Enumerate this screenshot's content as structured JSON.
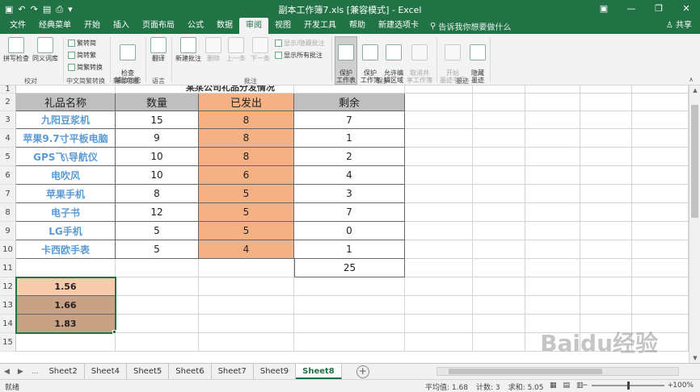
{
  "titlebar": {
    "title": "副本工作簿7.xls  [兼容模式]  -  Excel",
    "save_icon": "save-icon",
    "undo_icon": "undo-icon",
    "redo_icon": "redo-icon",
    "minimize": "—",
    "restore": "❐",
    "close": "✕",
    "ribbon_options": "▣"
  },
  "tabs": [
    "文件",
    "经典菜单",
    "开始",
    "插入",
    "页面布局",
    "公式",
    "数据",
    "审阅",
    "视图",
    "开发工具",
    "帮助",
    "新建选项卡"
  ],
  "active_tab": "审阅",
  "tellme": "告诉我你想要做什么",
  "share": "共享",
  "ribbon": {
    "spell": "拼写检查",
    "thesaurus": "同义词库",
    "proof_group": "校对",
    "trad_to_simp": "繁转简",
    "simp_to_trad": "简转繁",
    "convert": "简繁转换",
    "chinese_group": "中文简繁转换",
    "check_access": "检查\n辅助功能",
    "access_group": "辅助功能",
    "translate": "翻译",
    "lang_group": "语言",
    "new_comment": "新建批注",
    "delete": "删除",
    "prev": "上一条",
    "next": "下一条",
    "show_hide": "显示/隐藏批注",
    "show_all": "显示所有批注",
    "comment_group": "批注",
    "protect_sheet": "保护\n工作表",
    "protect_book": "保护\n工作簿",
    "allow_edit": "允许编\n辑区域",
    "unshare": "取消共\n享工作簿",
    "protect_group": "保护",
    "start_ink": "开始\n墨迹书写",
    "hide_ink": "隐藏\n墨迹",
    "ink_group": "墨迹"
  },
  "sheet": {
    "partial_title": "某某公司礼品分发情况",
    "rows": [
      "1",
      "2",
      "3",
      "4",
      "5",
      "6",
      "7",
      "8",
      "9",
      "10",
      "11",
      "12",
      "13",
      "14",
      "15"
    ],
    "headers": [
      "礼品名称",
      "数量",
      "已发出",
      "剩余"
    ],
    "items": [
      {
        "name": "九阳豆浆机",
        "qty": "15",
        "sent": "8",
        "left": "7"
      },
      {
        "name": "苹果9.7寸平板电脑",
        "qty": "9",
        "sent": "8",
        "left": "1"
      },
      {
        "name": "GPS飞\\导航仪",
        "qty": "10",
        "sent": "8",
        "left": "2"
      },
      {
        "name": "电吹风",
        "qty": "10",
        "sent": "6",
        "left": "4"
      },
      {
        "name": "苹果手机",
        "qty": "8",
        "sent": "5",
        "left": "3"
      },
      {
        "name": "电子书",
        "qty": "12",
        "sent": "5",
        "left": "7"
      },
      {
        "name": "LG手机",
        "qty": "5",
        "sent": "5",
        "left": "0"
      },
      {
        "name": "卡西欧手表",
        "qty": "5",
        "sent": "4",
        "left": "1"
      }
    ],
    "total_left": "25",
    "ratios": [
      {
        "value": "1.56",
        "color": "#f8cbad"
      },
      {
        "value": "1.66",
        "color": "#c9a184"
      },
      {
        "value": "1.83",
        "color": "#c9a184"
      }
    ]
  },
  "sheet_tabs": [
    "Sheet2",
    "Sheet4",
    "Sheet5",
    "Sheet6",
    "Sheet7",
    "Sheet9",
    "Sheet8"
  ],
  "active_sheet": "Sheet8",
  "sheet_nav": {
    "prev": "◀",
    "next": "▶",
    "more": "..."
  },
  "status": {
    "ready": "就绪",
    "average": "平均值: 1.68",
    "count": "计数: 3",
    "sum": "求和: 5.05",
    "zoom": "100%"
  },
  "watermark": "Baidu经验"
}
